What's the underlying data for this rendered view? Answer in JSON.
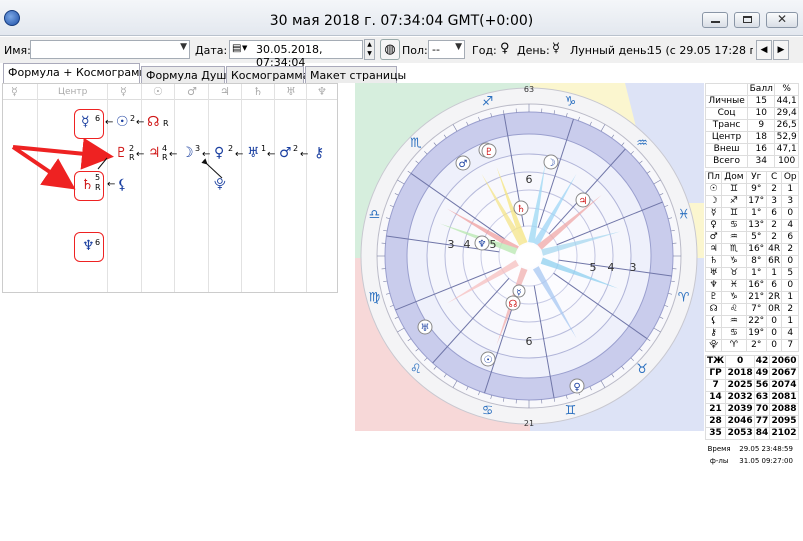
{
  "window": {
    "title": "30 мая 2018 г. 07:34:04 GMT(+0:00)",
    "close": "✕"
  },
  "toolbar": {
    "name_label": "Имя:",
    "name_value": "",
    "date_label": "Дата:",
    "date_value": "30.05.2018, 07:34:04",
    "pol_label": "Пол:",
    "pol_value": "--",
    "year_label": "Год:",
    "year_glyph": "♀",
    "day_label": "День:",
    "day_glyph": "☿",
    "lunar_label": "Лунный день:",
    "lunar_value": "15 (с 29.05 17:28 по 3"
  },
  "tabs": [
    "Формула + Космограмма",
    "Формула Души",
    "Космограмма",
    "Макет страницы"
  ],
  "formula": {
    "header": [
      "☿",
      "Центр",
      "☿",
      "☉",
      "♂",
      "♃",
      "♄",
      "♅",
      "♆"
    ],
    "center_label": "Центр",
    "items": {
      "mercury": "☿",
      "mercury_n": "6",
      "sun": "☉",
      "sun_n": "2",
      "node": "☊",
      "node_r": "R",
      "pluto": "♇",
      "pluto_n": "2",
      "pluto_r": "R",
      "jupiter": "♃",
      "jupiter_n": "4",
      "jupiter_r": "R",
      "moon": "☽",
      "moon_n": "3",
      "venus": "♀",
      "venus_n": "2",
      "uranus": "♅",
      "uranus_n": "1",
      "mars": "♂",
      "mars_n": "2",
      "chiron": "⚷",
      "saturn": "♄",
      "saturn_n": "5",
      "saturn_r": "R",
      "lilith": "⚸",
      "selena": "⯓",
      "neptune": "♆",
      "neptune_n": "6"
    }
  },
  "chart": {
    "degree_labels": [
      "63",
      "21"
    ],
    "signs": [
      "♋",
      "♊",
      "♉",
      "♈",
      "♓",
      "♒",
      "♑",
      "♐",
      "♏",
      "♎",
      "♍",
      "♌"
    ]
  },
  "stats": {
    "header": [
      "",
      "Балл",
      "%"
    ],
    "rows": [
      [
        "Личные",
        "15",
        "44,1"
      ],
      [
        "Соц",
        "10",
        "29,4"
      ],
      [
        "Транс",
        "9",
        "26,5"
      ],
      [
        "Центр",
        "18",
        "52,9"
      ],
      [
        "Внеш",
        "16",
        "47,1"
      ],
      [
        "Всего",
        "34",
        "100"
      ]
    ]
  },
  "planets": {
    "header": [
      "Пл",
      "Дом",
      "Уг",
      "С",
      "Ор"
    ],
    "rows": [
      [
        "☉",
        "♊",
        "9°",
        "2",
        "1"
      ],
      [
        "☽",
        "♐",
        "17°",
        "3",
        "3"
      ],
      [
        "☿",
        "♊",
        "1°",
        "6",
        "0"
      ],
      [
        "♀",
        "♋",
        "13°",
        "2",
        "4"
      ],
      [
        "♂",
        "♒",
        "5°",
        "2",
        "6"
      ],
      [
        "♃",
        "♏",
        "16°",
        "4R",
        "2"
      ],
      [
        "♄",
        "♑",
        "8°",
        "6R",
        "0"
      ],
      [
        "♅",
        "♉",
        "1°",
        "1",
        "5"
      ],
      [
        "♆",
        "♓",
        "16°",
        "6",
        "0"
      ],
      [
        "♇",
        "♑",
        "21°",
        "2R",
        "1"
      ],
      [
        "☊",
        "♌",
        "7°",
        "0R",
        "2"
      ],
      [
        "⚸",
        "♒",
        "22°",
        "0",
        "1"
      ],
      [
        "⚷",
        "♋",
        "19°",
        "0",
        "4"
      ],
      [
        "⯓",
        "♈",
        "2°",
        "0",
        "7"
      ]
    ]
  },
  "years": {
    "rows": [
      [
        "ТЖ",
        "0",
        "42",
        "2060"
      ],
      [
        "ГР",
        "2018",
        "49",
        "2067"
      ],
      [
        "7",
        "2025",
        "56",
        "2074"
      ],
      [
        "14",
        "2032",
        "63",
        "2081"
      ],
      [
        "21",
        "2039",
        "70",
        "2088"
      ],
      [
        "28",
        "2046",
        "77",
        "2095"
      ],
      [
        "35",
        "2053",
        "84",
        "2102"
      ]
    ]
  },
  "footer": {
    "time_label": "Время",
    "time_value": "29.05 23:48:59",
    "form_label": "ф-лы",
    "form_value": "31.05 09:27:00"
  }
}
